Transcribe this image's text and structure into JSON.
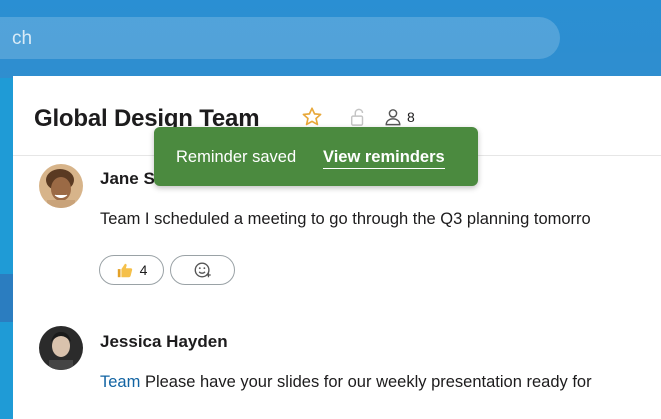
{
  "search": {
    "partial_text": "ch"
  },
  "channel": {
    "title": "Global Design Team",
    "member_count": "8"
  },
  "toast": {
    "message": "Reminder saved",
    "link": "View reminders"
  },
  "messages": [
    {
      "author": "Jane S",
      "text": "Team I scheduled a meeting to go through the Q3 planning tomorro",
      "reactions": [
        {
          "emoji": "thumbs-up",
          "count": "4"
        }
      ]
    },
    {
      "author": "Jessica Hayden",
      "mention": "Team",
      "text": " Please have your slides for our weekly presentation ready for"
    }
  ],
  "colors": {
    "toast_bg": "#4b8a3f",
    "mention": "#1264a3",
    "header": "#2f8ecf",
    "star": "#e8a83a"
  }
}
